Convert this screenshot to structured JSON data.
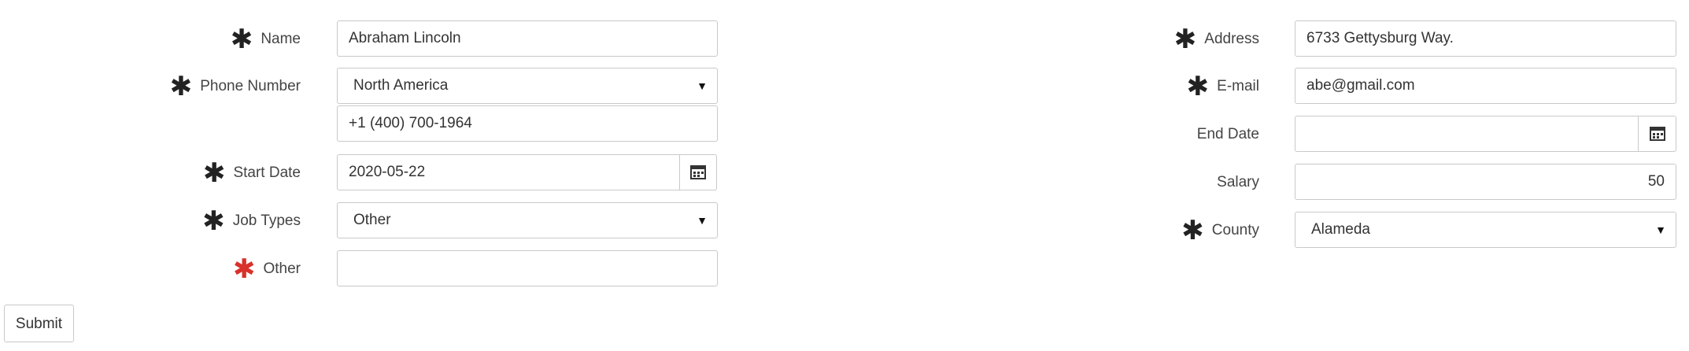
{
  "left": {
    "name": {
      "label": "Name",
      "value": "Abraham Lincoln"
    },
    "phone": {
      "label": "Phone Number",
      "region": "North America",
      "number": "+1 (400) 700-1964"
    },
    "start_date": {
      "label": "Start Date",
      "value": "2020-05-22"
    },
    "job_types": {
      "label": "Job Types",
      "value": "Other"
    },
    "other": {
      "label": "Other",
      "value": ""
    }
  },
  "right": {
    "address": {
      "label": "Address",
      "value": "6733 Gettysburg Way."
    },
    "email": {
      "label": "E-mail",
      "value": "abe@gmail.com"
    },
    "end_date": {
      "label": "End Date",
      "value": ""
    },
    "salary": {
      "label": "Salary",
      "value": "50"
    },
    "county": {
      "label": "County",
      "value": "Alameda"
    }
  },
  "submit_label": "Submit",
  "required_marker": "✱",
  "icons": {
    "select_caret": "caret-down",
    "date_picker": "calendar"
  },
  "colors": {
    "required_error": "#d9312b",
    "border": "#c9c9c9"
  }
}
